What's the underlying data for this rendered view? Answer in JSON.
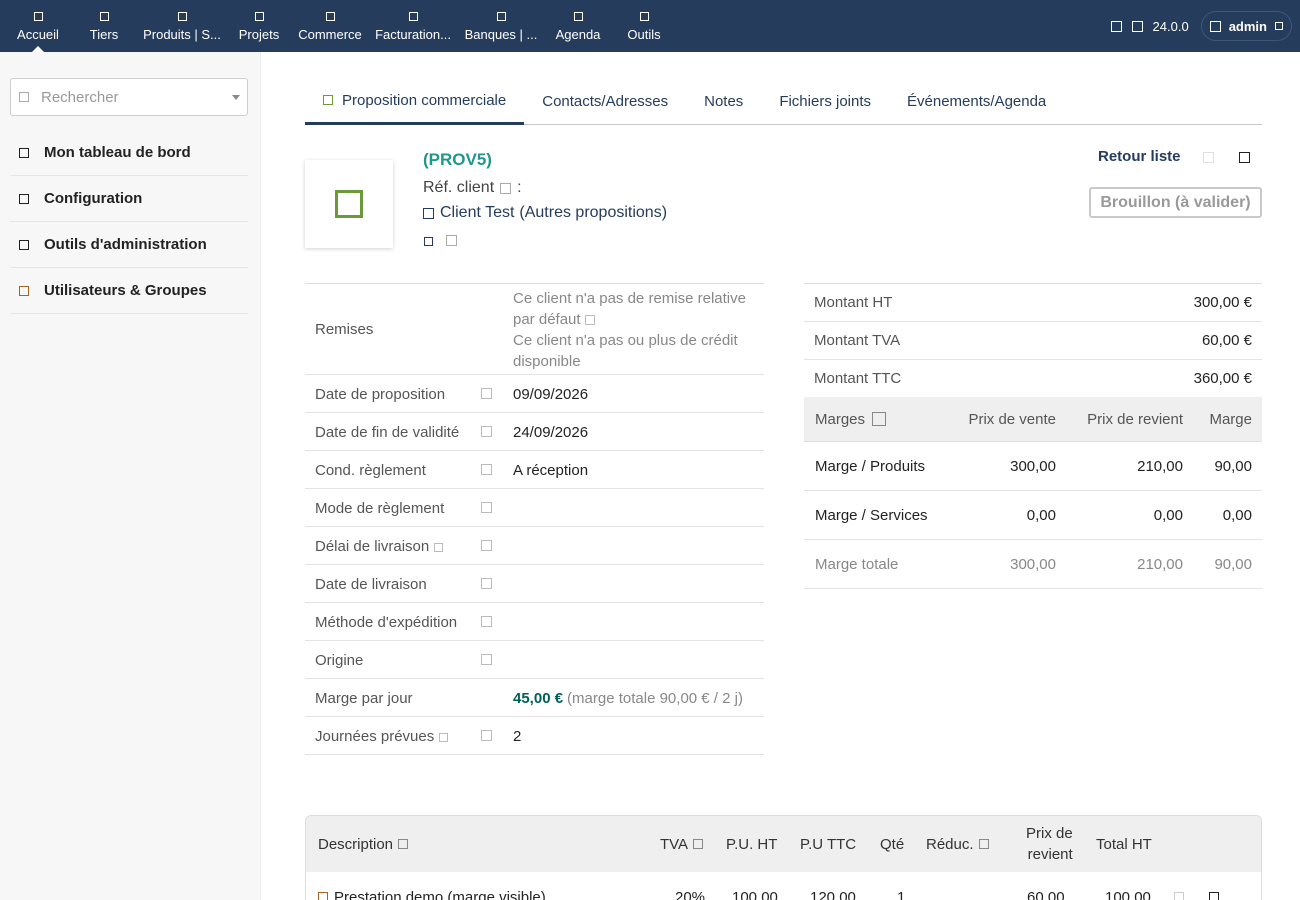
{
  "topbar": {
    "menu": [
      {
        "label": "Accueil",
        "icon": "home-icon",
        "active": true
      },
      {
        "label": "Tiers",
        "icon": "building-icon"
      },
      {
        "label": "Produits | S...",
        "icon": "cube-icon"
      },
      {
        "label": "Projets",
        "icon": "project-icon"
      },
      {
        "label": "Commerce",
        "icon": "suitcase-icon"
      },
      {
        "label": "Facturation...",
        "icon": "invoice-icon"
      },
      {
        "label": "Banques | ...",
        "icon": "bank-icon"
      },
      {
        "label": "Agenda",
        "icon": "calendar-icon"
      },
      {
        "label": "Outils",
        "icon": "tools-icon"
      }
    ],
    "version": "24.0.0",
    "user": "admin",
    "bg_color": "#263c5c"
  },
  "sidebar": {
    "search_placeholder": "Rechercher",
    "items": [
      {
        "label": "Mon tableau de bord"
      },
      {
        "label": "Configuration"
      },
      {
        "label": "Outils d'administration"
      },
      {
        "label": "Utilisateurs & Groupes"
      }
    ]
  },
  "tabs": [
    {
      "label": "Proposition commerciale",
      "active": true
    },
    {
      "label": "Contacts/Adresses"
    },
    {
      "label": "Notes"
    },
    {
      "label": "Fichiers joints"
    },
    {
      "label": "Événements/Agenda"
    }
  ],
  "header": {
    "ref": "(PROV5)",
    "ref_client_label": "Réf. client",
    "ref_client_sep": ":",
    "client_name": "Client Test",
    "client_other": "(Autres propositions)",
    "back_label": "Retour liste",
    "status": "Brouillon (à valider)"
  },
  "fields": {
    "remises": {
      "label": "Remises",
      "line1": "Ce client n'a pas de remise relative par défaut",
      "line2": "Ce client n'a pas ou plus de crédit disponible"
    },
    "date_prop": {
      "label": "Date de proposition",
      "value": "09/09/2026"
    },
    "date_fin": {
      "label": "Date de fin de validité",
      "value": "24/09/2026"
    },
    "cond_reg": {
      "label": "Cond. règlement",
      "value": "A réception"
    },
    "mode_reg": {
      "label": "Mode de règlement",
      "value": ""
    },
    "delai_liv": {
      "label": "Délai de livraison",
      "value": ""
    },
    "date_liv": {
      "label": "Date de livraison",
      "value": ""
    },
    "methode_exp": {
      "label": "Méthode d'expédition",
      "value": ""
    },
    "origine": {
      "label": "Origine",
      "value": ""
    },
    "marge_jour": {
      "label": "Marge par jour",
      "value": "45,00 €",
      "detail": "(marge totale 90,00 € / 2 j)"
    },
    "journees": {
      "label": "Journées prévues",
      "value": "2"
    }
  },
  "amounts": {
    "ht": {
      "label": "Montant HT",
      "value": "300,00 €"
    },
    "tva": {
      "label": "Montant TVA",
      "value": "60,00 €"
    },
    "ttc": {
      "label": "Montant TTC",
      "value": "360,00 €"
    }
  },
  "margins": {
    "head": {
      "label": "Marges",
      "sale": "Prix de vente",
      "cost": "Prix de revient",
      "margin": "Marge"
    },
    "products": {
      "label": "Marge / Produits",
      "sale": "300,00",
      "cost": "210,00",
      "margin": "90,00"
    },
    "services": {
      "label": "Marge / Services",
      "sale": "0,00",
      "cost": "0,00",
      "margin": "0,00"
    },
    "total": {
      "label": "Marge totale",
      "sale": "300,00",
      "cost": "210,00",
      "margin": "90,00"
    }
  },
  "lines": {
    "head": {
      "description": "Description",
      "tva": "TVA",
      "pu_ht": "P.U. HT",
      "pu_ttc": "P.U TTC",
      "qty": "Qté",
      "reduc": "Réduc.",
      "cost_1": "Prix de",
      "cost_2": "revient",
      "total_ht": "Total HT"
    },
    "rows": [
      {
        "description": "Prestation demo (marge visible)",
        "tva": "20%",
        "pu_ht": "100,00",
        "pu_ttc": "120,00",
        "qty": "1",
        "reduc": "",
        "cost": "60,00",
        "total_ht": "100,00"
      }
    ]
  }
}
